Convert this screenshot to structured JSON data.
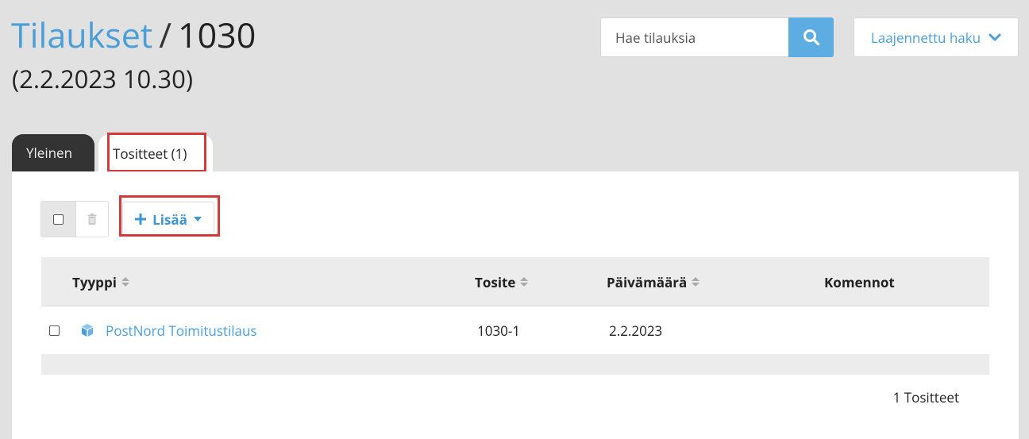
{
  "header": {
    "breadcrumb_link": "Tilaukset",
    "separator": "/",
    "order_number": "1030",
    "date": "(2.2.2023 10.30)"
  },
  "search": {
    "placeholder": "Hae tilauksia",
    "button_icon": "search-icon"
  },
  "advanced_search": {
    "label": "Laajennettu haku",
    "icon": "chevron-down-icon"
  },
  "tabs": [
    {
      "label": "Yleinen",
      "active": false
    },
    {
      "label": "Tositteet (1)",
      "active": true
    }
  ],
  "toolbar": {
    "add_label": "Lisää",
    "add_icon": "plus-icon",
    "delete_icon": "trash-icon"
  },
  "table": {
    "columns": [
      "Tyyppi",
      "Tosite",
      "Päivämäärä",
      "Komennot"
    ],
    "rows": [
      {
        "type": "PostNord Toimitustilaus",
        "type_icon": "package-icon",
        "document": "1030-1",
        "date": "2.2.2023",
        "commands": ""
      }
    ]
  },
  "footer": {
    "count_label": "1 Tositteet"
  },
  "colors": {
    "accent": "#4a9fd9",
    "search_button": "#5dade2",
    "highlight": "#d43a3a",
    "dark_tab": "#333333"
  }
}
